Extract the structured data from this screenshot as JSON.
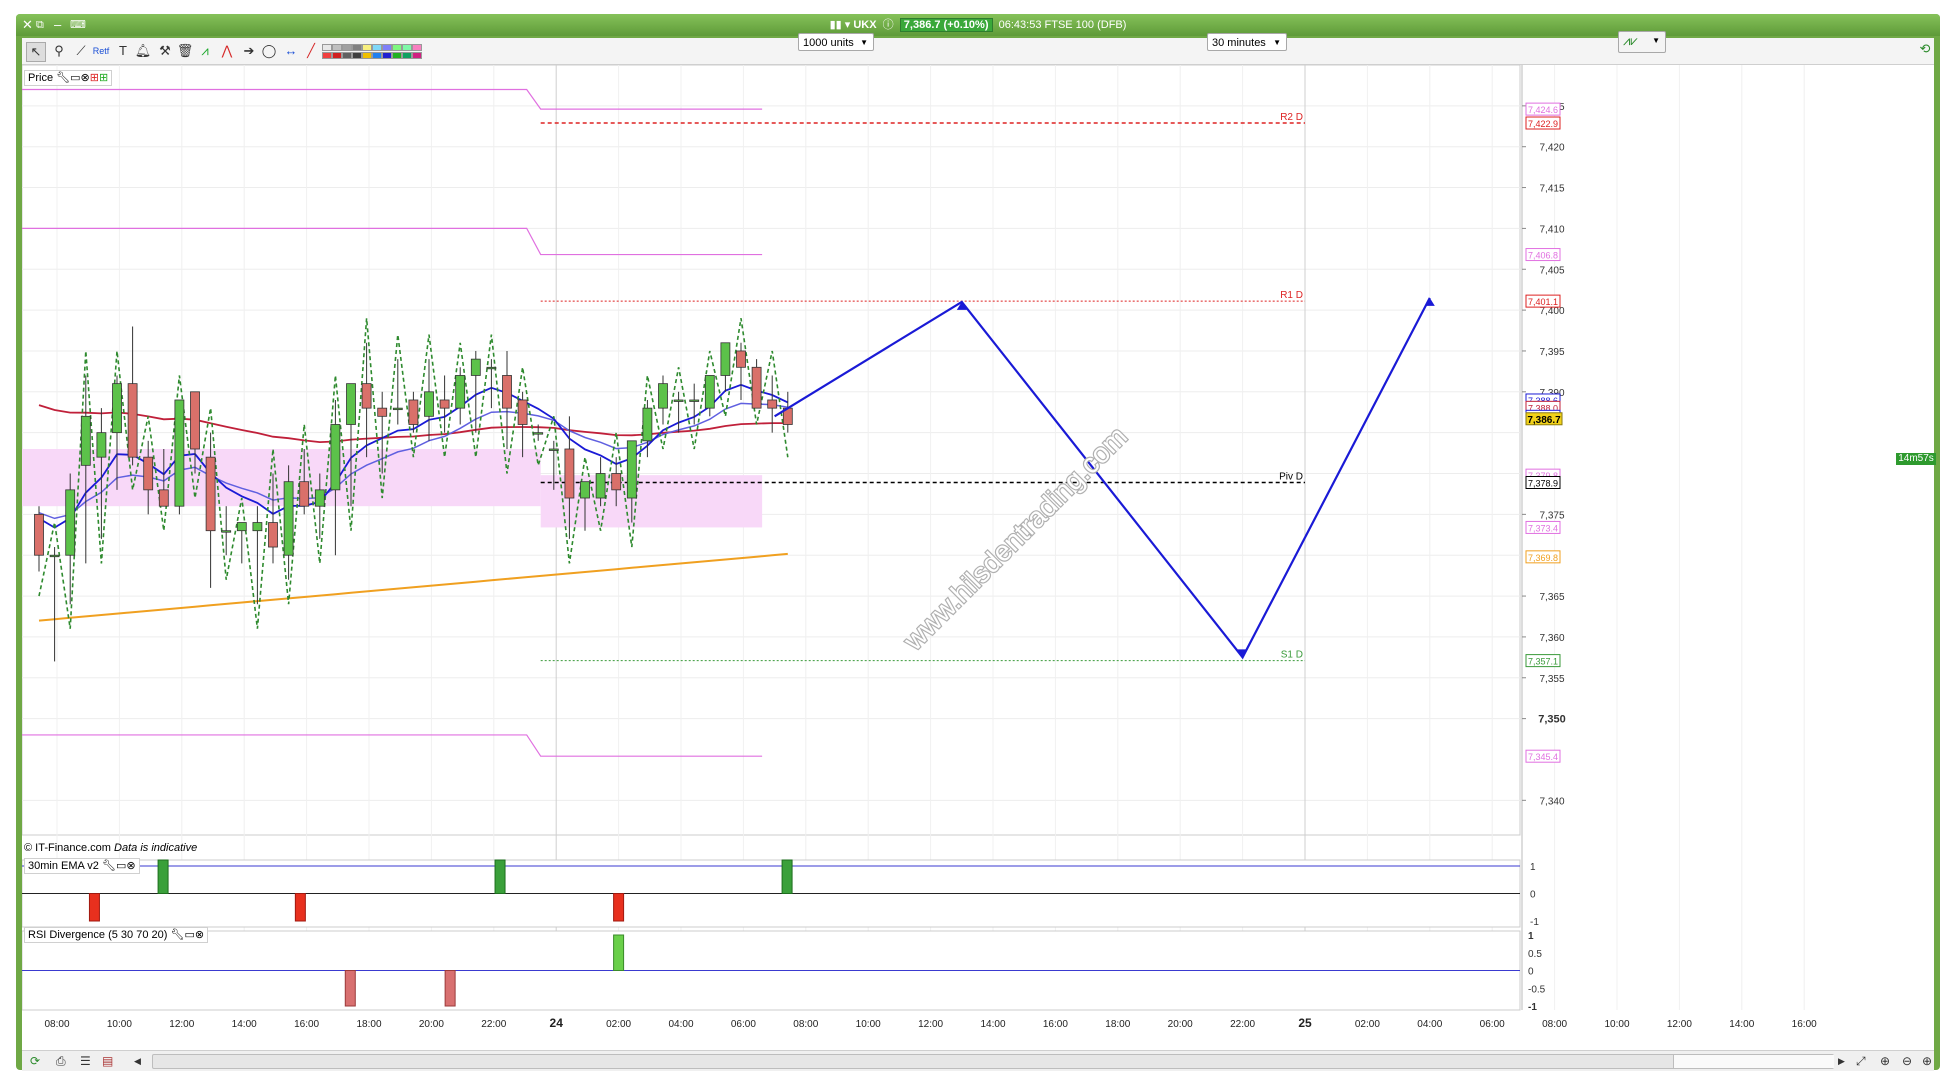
{
  "window": {
    "instrument_icon_label": "UKX",
    "price_change": "7,386.7 (+0.10%)",
    "time": "06:43:53",
    "instrument": "FTSE 100 (DFB)"
  },
  "toolbar": {
    "units_select": "1000 units",
    "interval_select": "30 minutes",
    "fib_label": "Retf"
  },
  "panels": {
    "price_label": "Price",
    "ema_label": "30min EMA v2",
    "rsi_label": "RSI Divergence (5 30 70 20)",
    "copyright": "© IT-Finance.com",
    "indicative": "Data is indicative",
    "countdown": "14m57s"
  },
  "watermark": "www.hilsdentrading.com",
  "colors": {
    "bull": "#5cc24a",
    "bear": "#d9706a",
    "pivot": "#000000",
    "resistance": "#dd2222",
    "support": "#3a9a3a",
    "forecast": "#1a1ad6",
    "ema_long": "#f0a020",
    "ema_mid": "#c0203a",
    "band": "#e070e0",
    "current_price_bg": "#f2d21a"
  },
  "chart_data": {
    "type": "candlestick",
    "instrument": "FTSE 100 (DFB)",
    "interval": "30 minutes",
    "current_price": 7386.7,
    "ylim": [
      7336,
      7430
    ],
    "y_ticks": [
      7340,
      7350,
      7355,
      7360,
      7365,
      7370,
      7375,
      7380,
      7385,
      7390,
      7395,
      7400,
      7405,
      7410,
      7415,
      7420,
      7425
    ],
    "y_tick_labels": [
      "7,340",
      "7,350",
      "7,355",
      "7,360",
      "7,365",
      "",
      "7,375",
      "",
      "",
      "7,390",
      "7,395",
      "7,400",
      "7,405",
      "7,410",
      "7,415",
      "7,420",
      "7,425"
    ],
    "x_labels": [
      "08:00",
      "10:00",
      "12:00",
      "14:00",
      "16:00",
      "18:00",
      "20:00",
      "22:00",
      "24",
      "02:00",
      "04:00",
      "06:00",
      "08:00",
      "10:00",
      "12:00",
      "14:00",
      "16:00",
      "18:00",
      "20:00",
      "22:00",
      "25",
      "02:00",
      "04:00",
      "06:00",
      "08:00",
      "10:00",
      "12:00",
      "14:00",
      "16:00"
    ],
    "candles": [
      [
        7375,
        7376,
        7368,
        7370
      ],
      [
        7370,
        7371,
        7357,
        7370
      ],
      [
        7370,
        7380,
        7364,
        7378
      ],
      [
        7381,
        7392,
        7369,
        7387
      ],
      [
        7382,
        7388,
        7372,
        7385
      ],
      [
        7385,
        7392,
        7378,
        7391
      ],
      [
        7391,
        7398,
        7381,
        7382
      ],
      [
        7382,
        7384,
        7375,
        7378
      ],
      [
        7378,
        7383,
        7376,
        7376
      ],
      [
        7376,
        7389,
        7375,
        7389
      ],
      [
        7390,
        7390,
        7380,
        7383
      ],
      [
        7382,
        7385,
        7366,
        7373
      ],
      [
        7373,
        7376,
        7370,
        7373
      ],
      [
        7373,
        7374,
        7369,
        7374
      ],
      [
        7373,
        7376,
        7364,
        7374
      ],
      [
        7374,
        7380,
        7369,
        7371
      ],
      [
        7370,
        7381,
        7367,
        7379
      ],
      [
        7379,
        7383,
        7375,
        7376
      ],
      [
        7376,
        7380,
        7372,
        7378
      ],
      [
        7378,
        7389,
        7370,
        7386
      ],
      [
        7386,
        7390,
        7376,
        7391
      ],
      [
        7391,
        7396,
        7382,
        7388
      ],
      [
        7388,
        7390,
        7380,
        7387
      ],
      [
        7388,
        7394,
        7386,
        7388
      ],
      [
        7389,
        7390,
        7385,
        7386
      ],
      [
        7387,
        7394,
        7384,
        7390
      ],
      [
        7389,
        7392,
        7385,
        7388
      ],
      [
        7388,
        7393,
        7386,
        7392
      ],
      [
        7392,
        7395,
        7385,
        7394
      ],
      [
        7393,
        7394,
        7388,
        7393
      ],
      [
        7392,
        7395,
        7383,
        7388
      ],
      [
        7389,
        7390,
        7382,
        7386
      ],
      [
        7385,
        7386,
        7384,
        7385
      ],
      [
        7383,
        7384,
        7378,
        7383
      ],
      [
        7383,
        7387,
        7372,
        7377
      ],
      [
        7377,
        7379,
        7373,
        7379
      ],
      [
        7377,
        7382,
        7376,
        7380
      ],
      [
        7380,
        7382,
        7376,
        7378
      ],
      [
        7377,
        7384,
        7374,
        7384
      ],
      [
        7384,
        7389,
        7382,
        7388
      ],
      [
        7388,
        7392,
        7386,
        7391
      ],
      [
        7389,
        7390,
        7385,
        7389
      ],
      [
        7389,
        7391,
        7386,
        7389
      ],
      [
        7388,
        7392,
        7387,
        7392
      ],
      [
        7392,
        7396,
        7390,
        7396
      ],
      [
        7395,
        7396,
        7389,
        7393
      ],
      [
        7393,
        7394,
        7389,
        7388
      ],
      [
        7389,
        7392,
        7385,
        7388
      ],
      [
        7388,
        7390,
        7385,
        7386
      ]
    ],
    "levels": [
      {
        "name": "R2 D",
        "value": 7422.9,
        "color": "#dd2222"
      },
      {
        "name": "R1 D",
        "value": 7401.1,
        "color": "#dd2222"
      },
      {
        "name": "Piv D",
        "value": 7378.9,
        "color": "#000000"
      },
      {
        "name": "S1 D",
        "value": 7357.1,
        "color": "#3a9a3a"
      }
    ],
    "band_lines": [
      {
        "prev": 7427,
        "curr": 7424.6,
        "label": "7,424.6"
      },
      {
        "prev": 7410,
        "curr": 7406.8,
        "label": "7,406.8"
      },
      {
        "prev": 7348,
        "curr": 7345.4,
        "label": "7,345.4"
      }
    ],
    "band_zone": {
      "prev": [
        7376,
        7383
      ],
      "curr": [
        7373.4,
        7379.8
      ],
      "labels": [
        "7,379.8",
        "7,373.4"
      ]
    },
    "right_badges": [
      {
        "label": "7,388.6",
        "value": 7389.0,
        "color": "#1a1ad6"
      },
      {
        "label": "7,388.0",
        "value": 7388.1,
        "color": "#c0203a"
      },
      {
        "label": "7,386.9",
        "value": 7387.0,
        "color": "#1a1ad6"
      },
      {
        "label": "7,369.8",
        "value": 7369.8,
        "color": "#f0a020"
      }
    ],
    "forecast_path": [
      [
        11.5,
        7387
      ],
      [
        14.5,
        7401
      ],
      [
        19.0,
        7357.5
      ],
      [
        22.0,
        7401.5
      ]
    ],
    "ema_signal": {
      "ylim": [
        -1,
        1
      ],
      "ticks": [
        "1",
        "0",
        "-1"
      ],
      "up_bars": [
        1.7,
        7.1,
        11.7
      ],
      "down_bars": [
        0.6,
        3.9,
        9.0
      ]
    },
    "rsi": {
      "ylim": [
        -1,
        1
      ],
      "ticks": [
        "1",
        "0.5",
        "0",
        "-0.5",
        "-1"
      ],
      "up_bars": [
        9.0
      ],
      "down_bars": [
        4.7,
        6.3
      ]
    }
  }
}
